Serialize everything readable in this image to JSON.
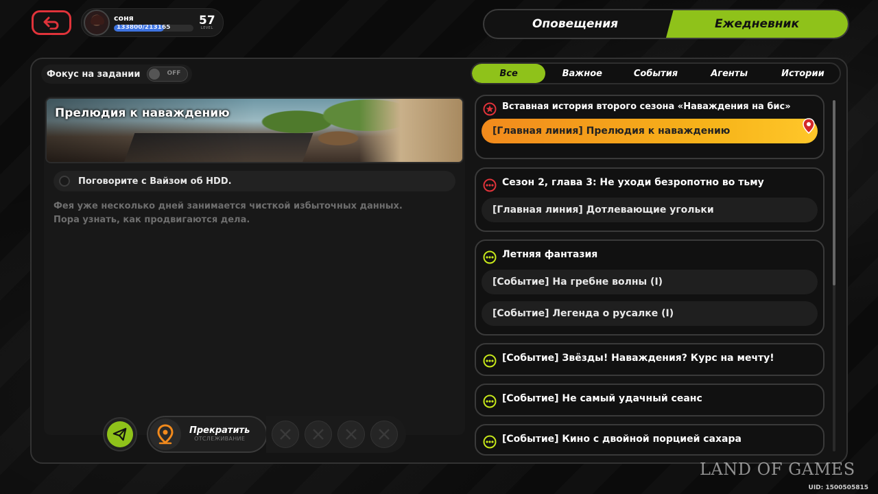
{
  "profile": {
    "name": "соня",
    "exp_text": "133800/213165",
    "exp_fraction": 0.628,
    "level": "57",
    "level_label": "LEVEL"
  },
  "top_tabs": [
    {
      "label": "Оповещения",
      "active": false
    },
    {
      "label": "Ежедневник",
      "active": true
    }
  ],
  "focus": {
    "label": "Фокус на задании",
    "toggle_state": "OFF"
  },
  "quest": {
    "title": "Прелюдия к наваждению",
    "task": "Поговорите с Вайзом об HDD.",
    "description_lines": [
      "Фея уже несколько дней занимается чисткой избыточных данных.",
      "Пора узнать, как продвигаются дела."
    ]
  },
  "controls": {
    "stop_label": "Прекратить",
    "stop_sub": "ОТСЛЕЖИВАНИЕ"
  },
  "filters": [
    {
      "label": "Все",
      "active": true
    },
    {
      "label": "Важное",
      "active": false
    },
    {
      "label": "События",
      "active": false
    },
    {
      "label": "Агенты",
      "active": false
    },
    {
      "label": "Истории",
      "active": false
    }
  ],
  "quest_list": [
    {
      "title": "Вставная история второго сезона «Наваждения на бис»",
      "icon": "star-badge-icon",
      "items": [
        "[Главная линия] Прелюдия к наваждению"
      ]
    },
    {
      "title": "Сезон 2, глава 3: Не уходи безропотно во тьму",
      "icon": "red-dots-icon",
      "items": [
        "[Главная линия] Дотлевающие угольки"
      ]
    },
    {
      "title": "Летняя фантазия",
      "icon": "green-dots-icon",
      "items": [
        "[Событие] На гребне волны (I)",
        "[Событие] Легенда о русалке (I)"
      ]
    },
    {
      "title": "[Событие] Звёзды! Наваждения? Курс на мечту!",
      "icon": "green-dots-icon",
      "items": []
    },
    {
      "title": "[Событие] Не самый удачный сеанс",
      "icon": "green-dots-icon",
      "items": []
    },
    {
      "title": "[Событие] Кино с двойной порцией сахара",
      "icon": "green-dots-icon",
      "items": []
    }
  ],
  "colors": {
    "accent": "#8fc21a",
    "back_button": "#e0333a",
    "highlight_start": "#f28a1c",
    "highlight_end": "#ffc72a",
    "exp_bar": "#3d73e0"
  },
  "watermark": "LAND OF GAMES",
  "uid": "UID: 1500505815"
}
